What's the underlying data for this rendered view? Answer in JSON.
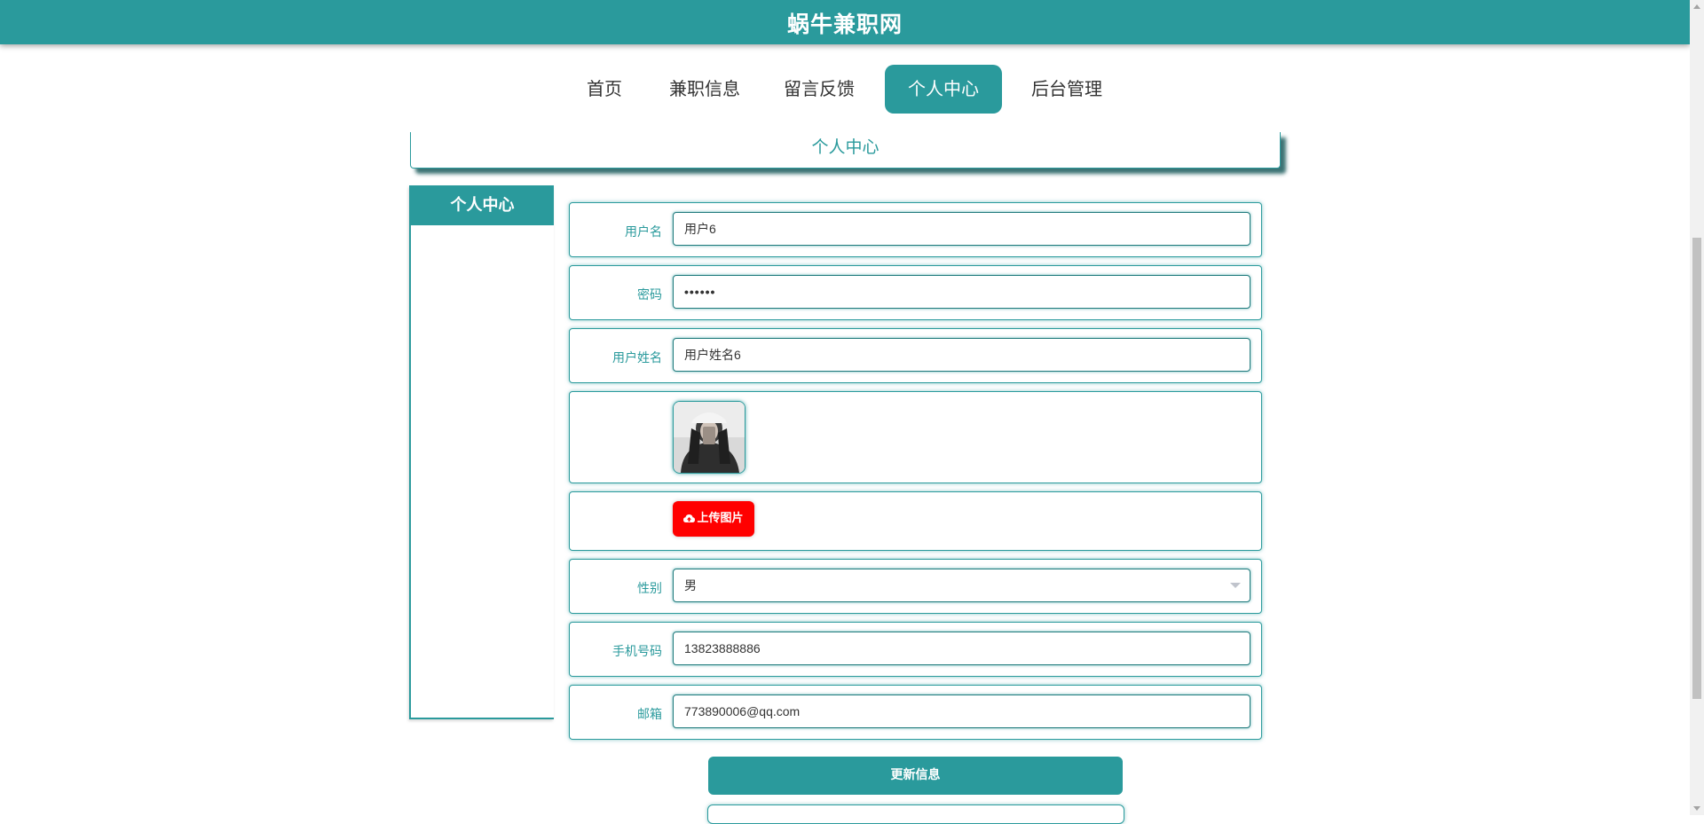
{
  "header": {
    "site_title": "蜗牛兼职网"
  },
  "nav": {
    "items": [
      {
        "label": "首页",
        "active": false
      },
      {
        "label": "兼职信息",
        "active": false
      },
      {
        "label": "留言反馈",
        "active": false
      },
      {
        "label": "个人中心",
        "active": true
      },
      {
        "label": "后台管理",
        "active": false
      }
    ]
  },
  "page_header": {
    "title": "个人中心"
  },
  "sidebar": {
    "title": "个人中心"
  },
  "form": {
    "username": {
      "label": "用户名",
      "value": "用户6"
    },
    "password": {
      "label": "密码",
      "value": "••••••"
    },
    "realname": {
      "label": "用户姓名",
      "value": "用户姓名6"
    },
    "avatar": {
      "icon": "avatar-photo"
    },
    "upload": {
      "label": "上传图片",
      "icon": "cloud-upload-icon"
    },
    "gender": {
      "label": "性别",
      "value": "男"
    },
    "phone": {
      "label": "手机号码",
      "value": "13823888886"
    },
    "email": {
      "label": "邮箱",
      "value": "773890006@qq.com"
    },
    "submit_label": "更新信息"
  },
  "colors": {
    "primary": "#2a9a9c",
    "upload_button": "#ff0000"
  }
}
